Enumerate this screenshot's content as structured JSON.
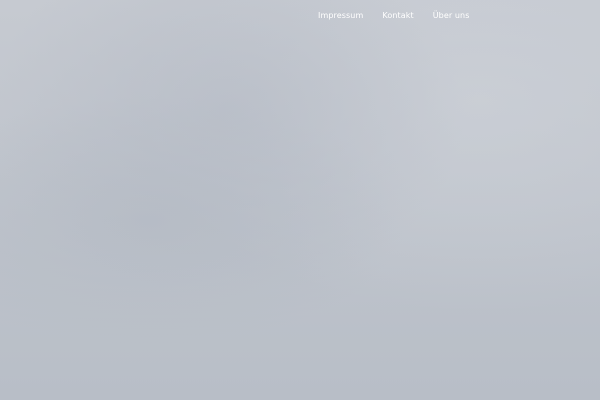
{
  "nav": {
    "items": [
      {
        "label": "Impressum"
      },
      {
        "label": "Kontakt"
      },
      {
        "label": "Über uns"
      }
    ]
  },
  "colors": {
    "background": "#c2c7cf",
    "nav_text": "#ffffff"
  }
}
